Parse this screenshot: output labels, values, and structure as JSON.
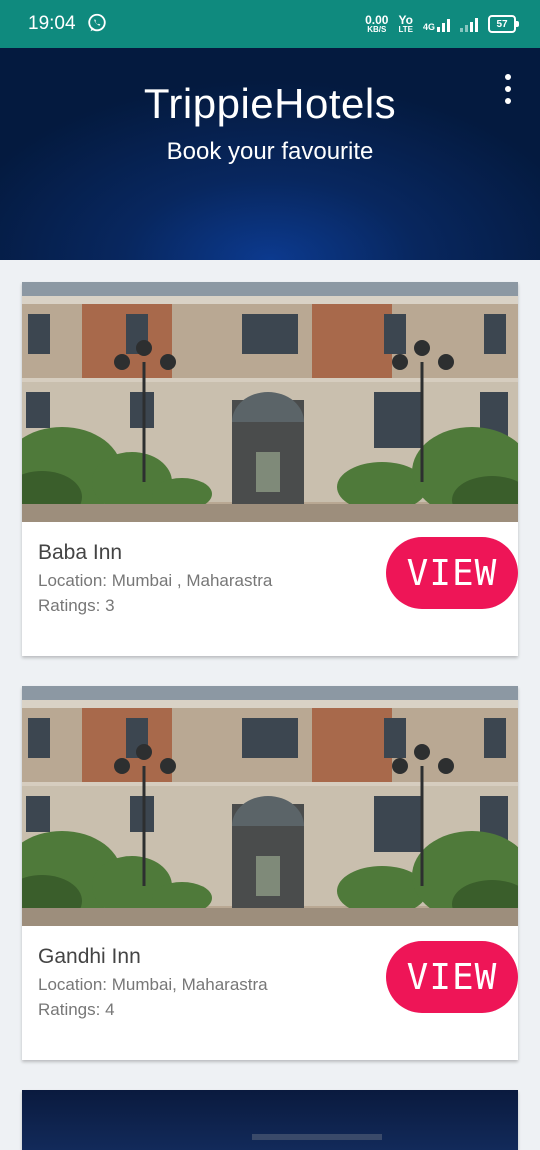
{
  "status_bar": {
    "time": "19:04",
    "speed_value": "0.00",
    "speed_unit": "KB/S",
    "volte_top": "Yo",
    "volte_bottom": "LTE",
    "network_type": "4G",
    "battery": "57",
    "icons": [
      "whatsapp-icon",
      "signal-icon",
      "battery-icon"
    ]
  },
  "header": {
    "title": "TrippieHotels",
    "subtitle": "Book your favourite",
    "menu_icon": "more-vert-icon"
  },
  "hotels": [
    {
      "name": "Baba Inn",
      "location": "Location: Mumbai , Maharastra",
      "rating": "Ratings: 3",
      "button_label": "VIEW"
    },
    {
      "name": "Gandhi Inn",
      "location": "Location: Mumbai, Maharastra",
      "rating": "Ratings: 4",
      "button_label": "VIEW"
    }
  ],
  "colors": {
    "status_bar": "#0f8a7e",
    "header_dark": "#041a3f",
    "header_light": "#0c3a8f",
    "accent": "#ee1557",
    "page_background": "#eef1f4"
  }
}
